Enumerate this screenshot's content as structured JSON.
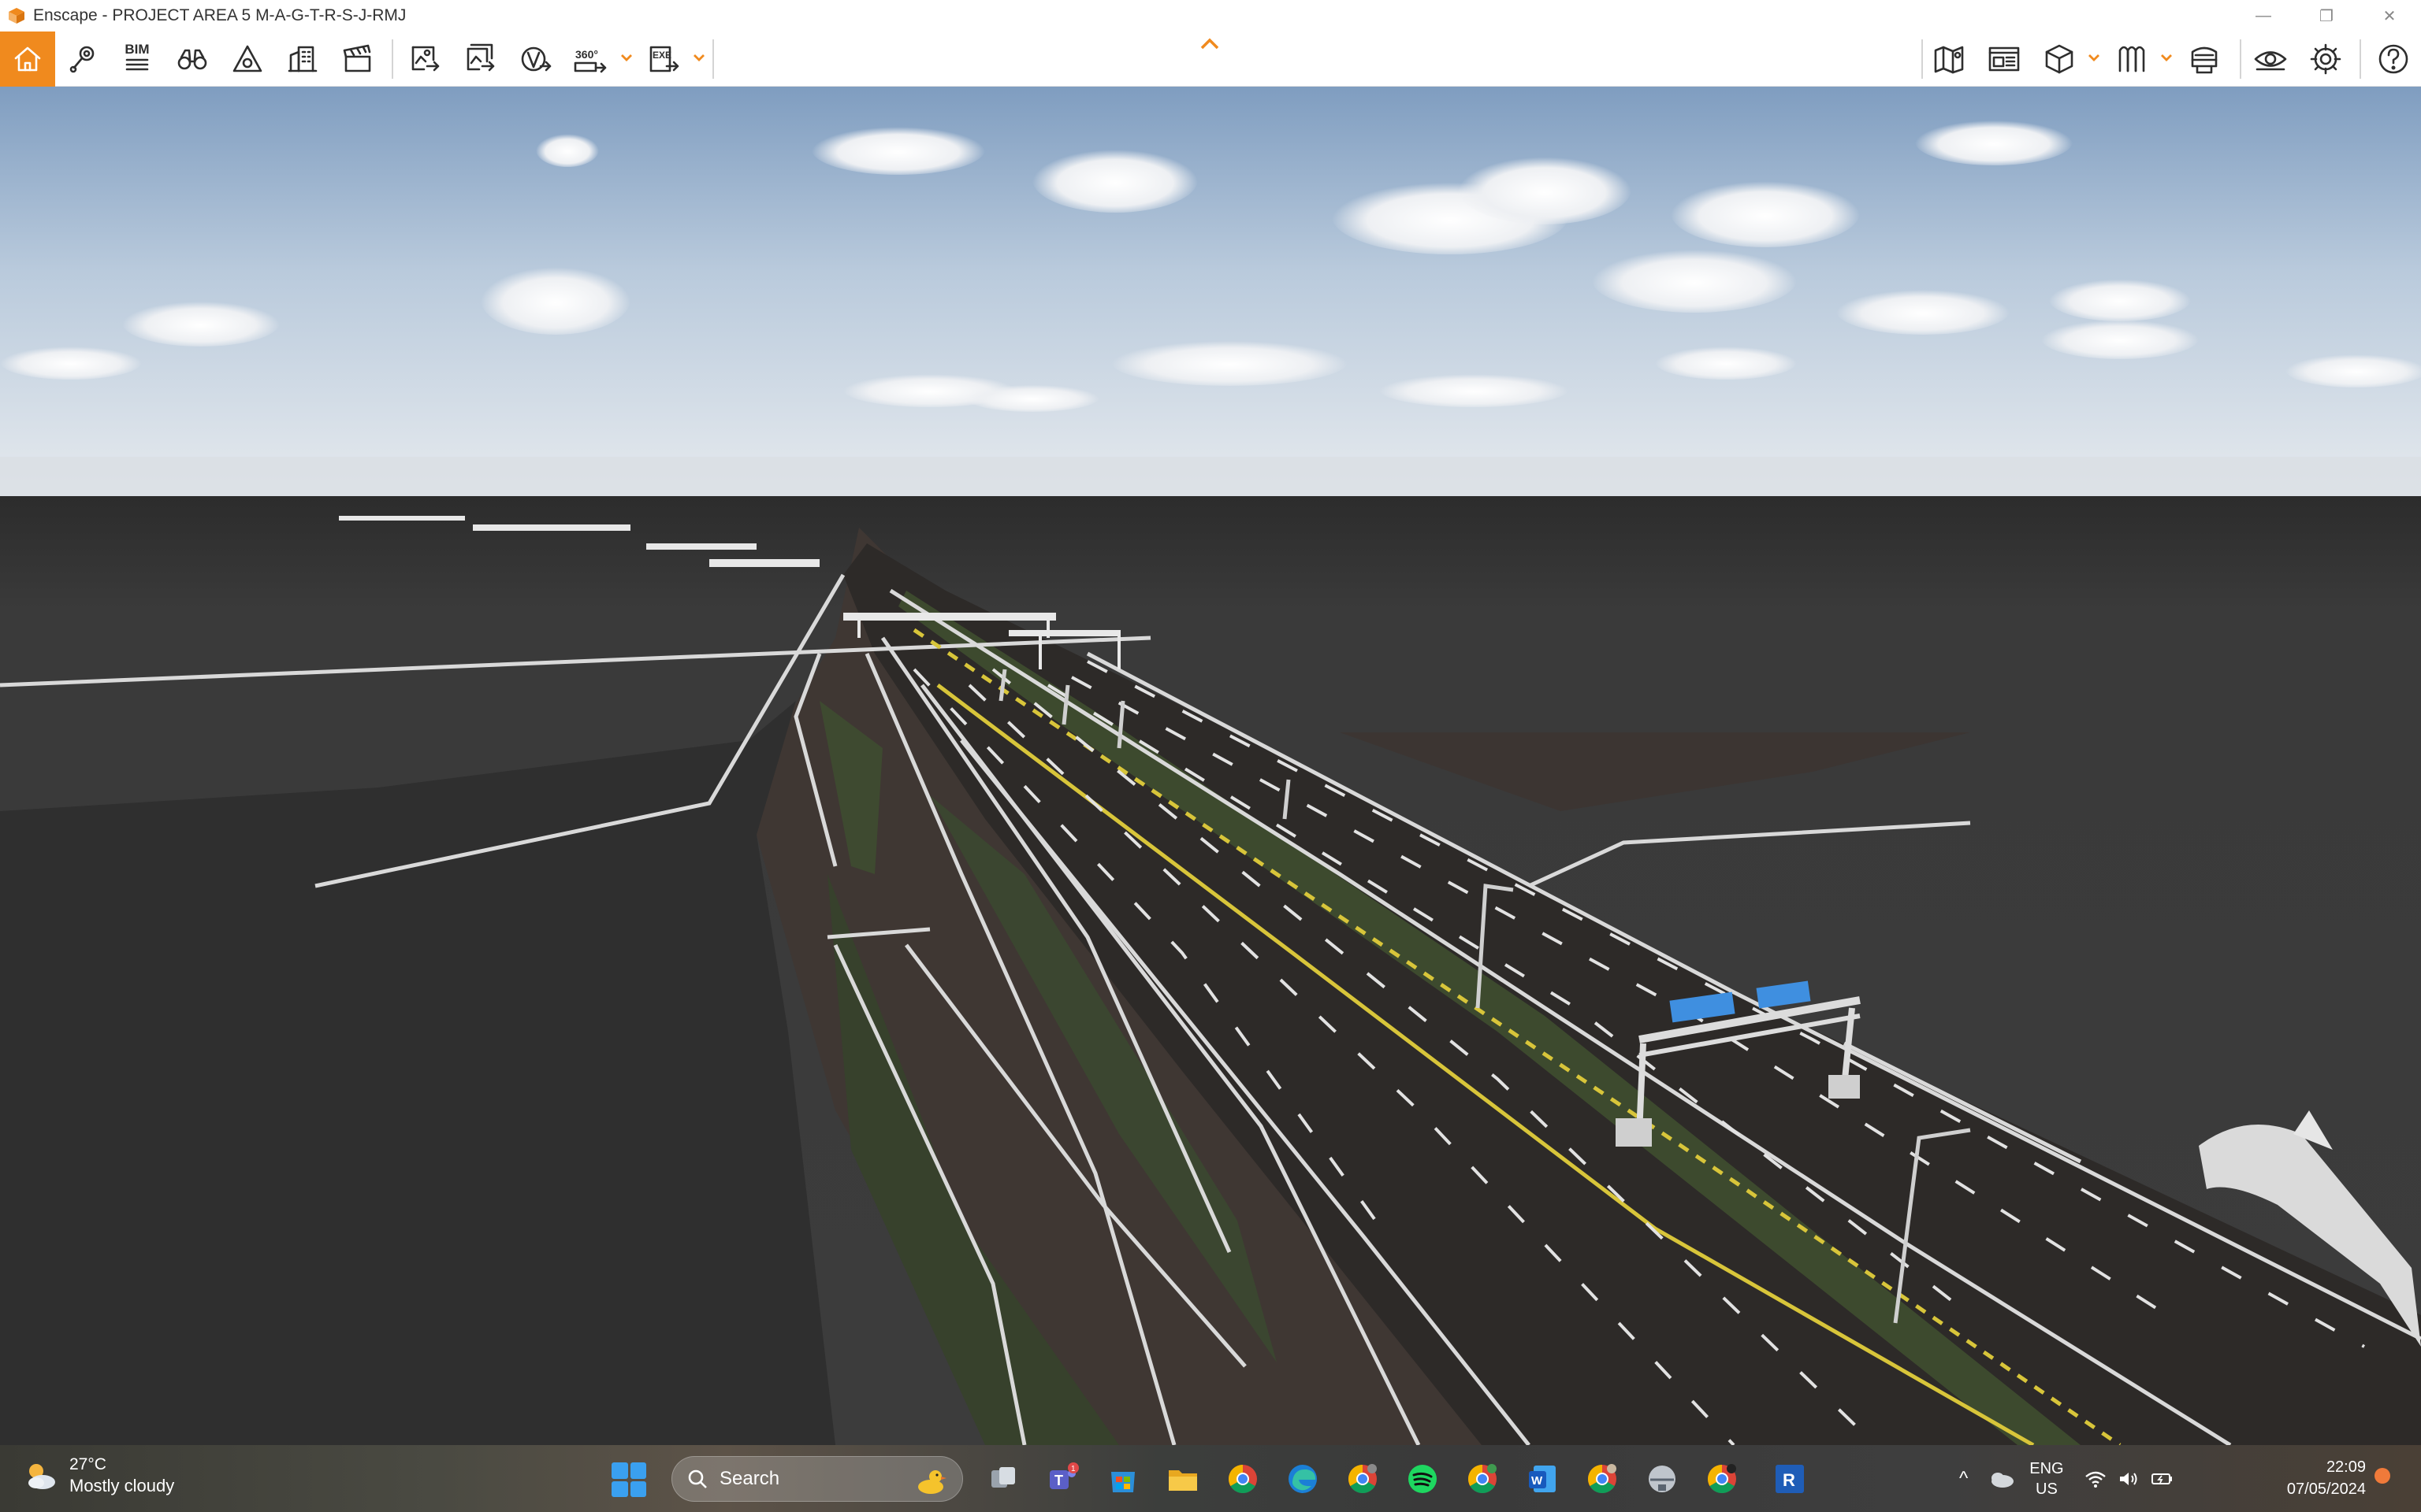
{
  "window": {
    "title": "Enscape - PROJECT AREA 5 M-A-G-T-R-S-J-RMJ",
    "controls": [
      "minimize",
      "restore",
      "close"
    ],
    "control_glyphs": {
      "minimize": "—",
      "restore": "❐",
      "close": "✕"
    }
  },
  "toolbar": {
    "accent_color": "#f08a1e",
    "left_tools": [
      {
        "name": "home",
        "icon": "home-icon",
        "active": true
      },
      {
        "name": "views",
        "icon": "location-pin-icon"
      },
      {
        "name": "bim",
        "icon": "bim-list-icon",
        "label": "BIM"
      },
      {
        "name": "navigation",
        "icon": "binoculars-icon"
      },
      {
        "name": "sketch",
        "icon": "triangle-icon"
      },
      {
        "name": "asset-library",
        "icon": "buildings-icon"
      },
      {
        "name": "video-editor",
        "icon": "clapperboard-icon"
      },
      {
        "name": "render-image",
        "icon": "export-image-icon"
      },
      {
        "name": "batch-render",
        "icon": "batch-export-icon"
      },
      {
        "name": "web-standalone",
        "icon": "web-export-icon"
      },
      {
        "name": "panorama",
        "icon": "panorama-360-icon",
        "label": "360°"
      },
      {
        "name": "exe-standalone",
        "icon": "exe-export-icon",
        "label": "EXE"
      }
    ],
    "right_tools": [
      {
        "name": "site-context",
        "icon": "map-icon"
      },
      {
        "name": "minimap",
        "icon": "minimap-icon"
      },
      {
        "name": "view-cube",
        "icon": "cube-icon"
      },
      {
        "name": "material-editor",
        "icon": "material-icon"
      },
      {
        "name": "upload",
        "icon": "upload-icon"
      },
      {
        "name": "visual-settings",
        "icon": "eye-icon"
      },
      {
        "name": "general-settings",
        "icon": "gear-icon"
      },
      {
        "name": "help",
        "icon": "help-icon"
      }
    ]
  },
  "viewport": {
    "description_ref": "3D render viewport",
    "sky_color_top": "#8aa6c6",
    "sky_color_horizon": "#e3e8ee",
    "ground_color": "#3a3a3a"
  },
  "taskbar": {
    "weather": {
      "temp": "27°C",
      "desc": "Mostly cloudy"
    },
    "search": {
      "placeholder": "Search"
    },
    "apps": [
      {
        "name": "task-view",
        "icon": "task-view-icon"
      },
      {
        "name": "teams",
        "icon": "teams-icon",
        "badge": "1"
      },
      {
        "name": "microsoft-store",
        "icon": "store-icon"
      },
      {
        "name": "file-explorer",
        "icon": "folder-icon"
      },
      {
        "name": "chrome",
        "icon": "chrome-icon"
      },
      {
        "name": "edge",
        "icon": "edge-icon"
      },
      {
        "name": "chrome-profile-2",
        "icon": "chrome-icon"
      },
      {
        "name": "spotify",
        "icon": "spotify-icon"
      },
      {
        "name": "chrome-profile-3",
        "icon": "chrome-icon"
      },
      {
        "name": "word",
        "icon": "word-icon",
        "label": "W"
      },
      {
        "name": "chrome-profile-4",
        "icon": "chrome-icon"
      },
      {
        "name": "network-drive",
        "icon": "drive-icon"
      },
      {
        "name": "chrome-profile-5",
        "icon": "chrome-icon"
      },
      {
        "name": "revit",
        "icon": "revit-icon",
        "label": "R"
      }
    ],
    "tray": {
      "chevron": "^",
      "language_top": "ENG",
      "language_bottom": "US"
    },
    "clock": {
      "time": "22:09",
      "date": "07/05/2024"
    }
  }
}
